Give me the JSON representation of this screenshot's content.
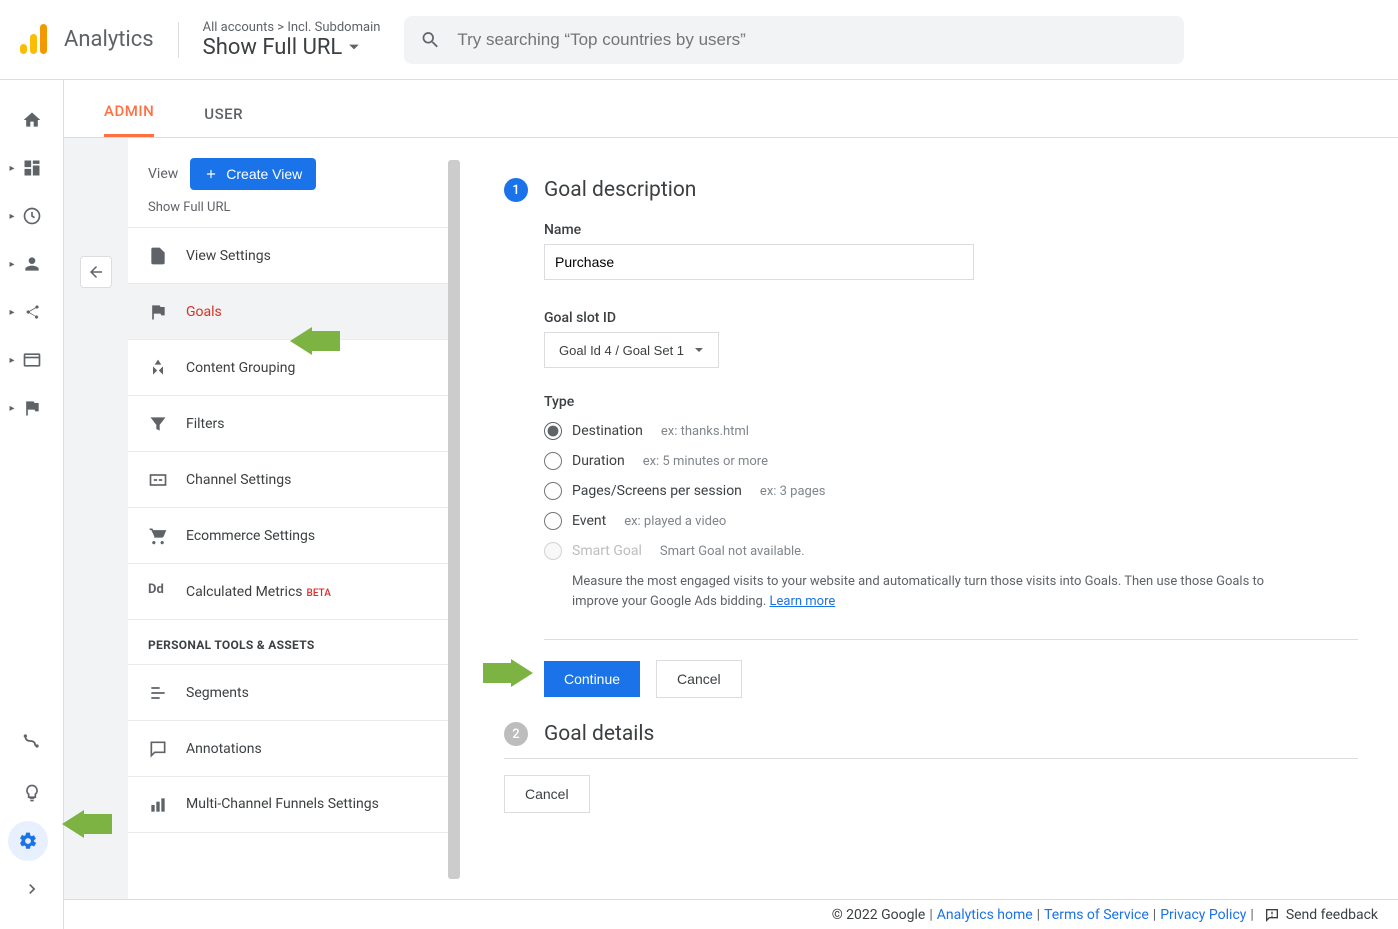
{
  "header": {
    "productName": "Analytics",
    "breadcrumb": "All accounts > Incl. Subdomain",
    "viewName": "Show Full URL",
    "searchPlaceholder": "Try searching “Top countries by users”"
  },
  "tabs": {
    "admin": "ADMIN",
    "user": "USER"
  },
  "adminCol": {
    "viewLabel": "View",
    "createView": "Create View",
    "subtitle": "Show Full URL",
    "items": [
      "View Settings",
      "Goals",
      "Content Grouping",
      "Filters",
      "Channel Settings",
      "Ecommerce Settings",
      "Calculated Metrics"
    ],
    "beta": "BETA",
    "personalLabel": "PERSONAL TOOLS & ASSETS",
    "personalItems": [
      "Segments",
      "Annotations",
      "Multi-Channel Funnels Settings"
    ]
  },
  "form": {
    "step1Title": "Goal description",
    "nameLabel": "Name",
    "nameValue": "Purchase",
    "slotLabel": "Goal slot ID",
    "slotValue": "Goal Id 4 / Goal Set 1",
    "typeLabel": "Type",
    "radios": [
      {
        "label": "Destination",
        "hint": "ex: thanks.html"
      },
      {
        "label": "Duration",
        "hint": "ex: 5 minutes or more"
      },
      {
        "label": "Pages/Screens per session",
        "hint": "ex: 3 pages"
      },
      {
        "label": "Event",
        "hint": "ex: played a video"
      },
      {
        "label": "Smart Goal",
        "hint": "Smart Goal not available."
      }
    ],
    "smartDesc": "Measure the most engaged visits to your website and automatically turn those visits into Goals. Then use those Goals to improve your Google Ads bidding. ",
    "learnMore": "Learn more",
    "continueBtn": "Continue",
    "cancelBtn": "Cancel",
    "step2Title": "Goal details"
  },
  "footer": {
    "copyright": "© 2022 Google",
    "links": [
      "Analytics home",
      "Terms of Service",
      "Privacy Policy"
    ],
    "feedback": "Send feedback"
  }
}
